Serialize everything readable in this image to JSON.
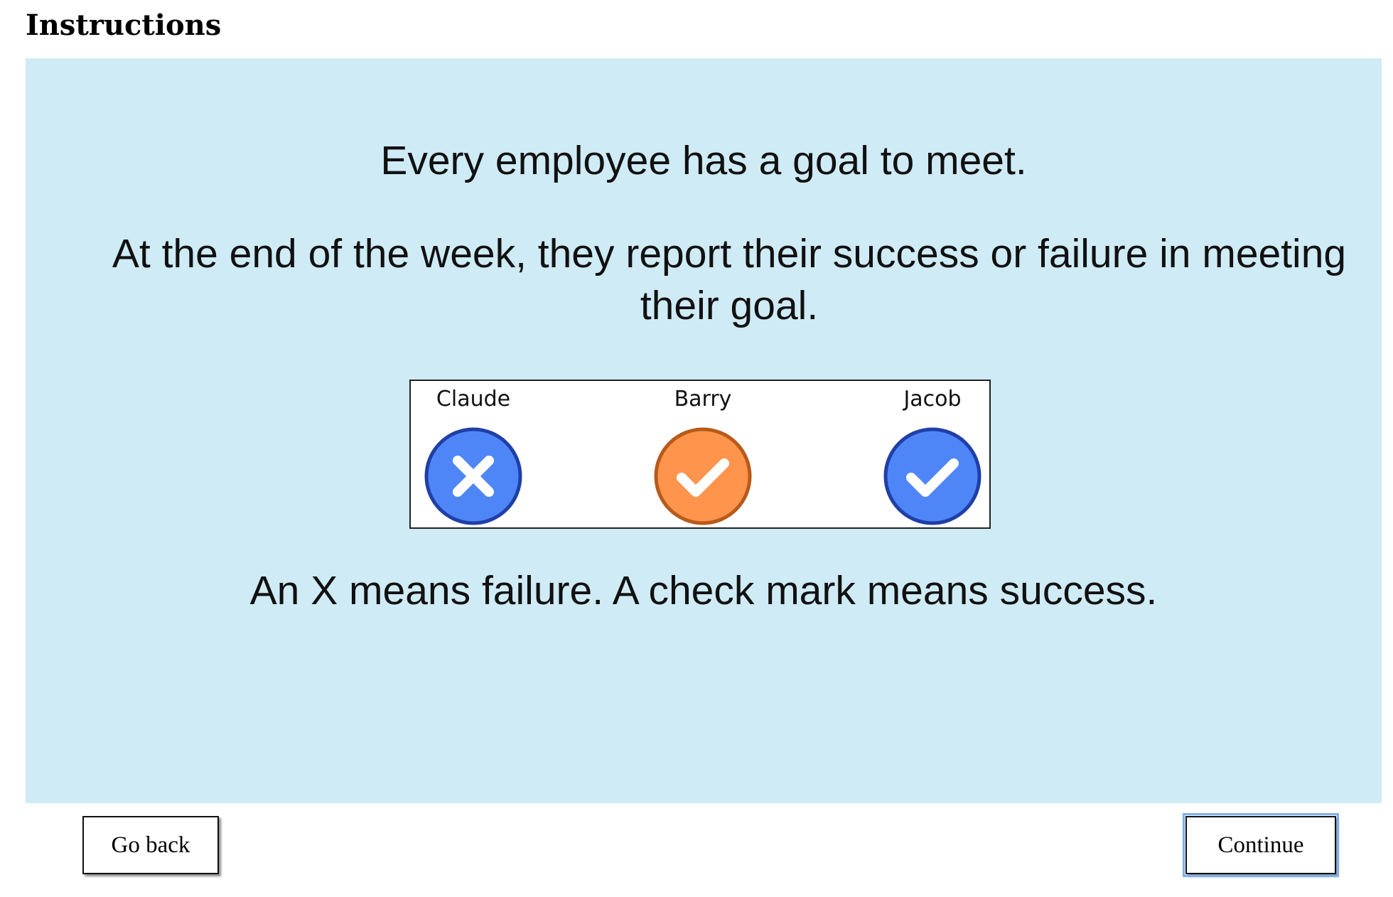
{
  "page": {
    "heading": "Instructions"
  },
  "panel": {
    "background": "#cfebf5",
    "line_1": "Every employee has a goal to meet.",
    "line_2": "At the end of the week, they report their success or failure in meeting their goal.",
    "line_3": "An X means failure. A check mark means success."
  },
  "example": {
    "employees": [
      {
        "name": "Claude",
        "status": "failure",
        "icon": "x-circle-icon",
        "color": "#4f86f7",
        "border": "#1f3fa8"
      },
      {
        "name": "Barry",
        "status": "success",
        "icon": "check-circle-icon",
        "color": "#ff944d",
        "border": "#b85a1a"
      },
      {
        "name": "Jacob",
        "status": "success",
        "icon": "check-circle-icon",
        "color": "#4f86f7",
        "border": "#1f3fa8"
      }
    ]
  },
  "buttons": {
    "back_label": "Go back",
    "continue_label": "Continue"
  }
}
